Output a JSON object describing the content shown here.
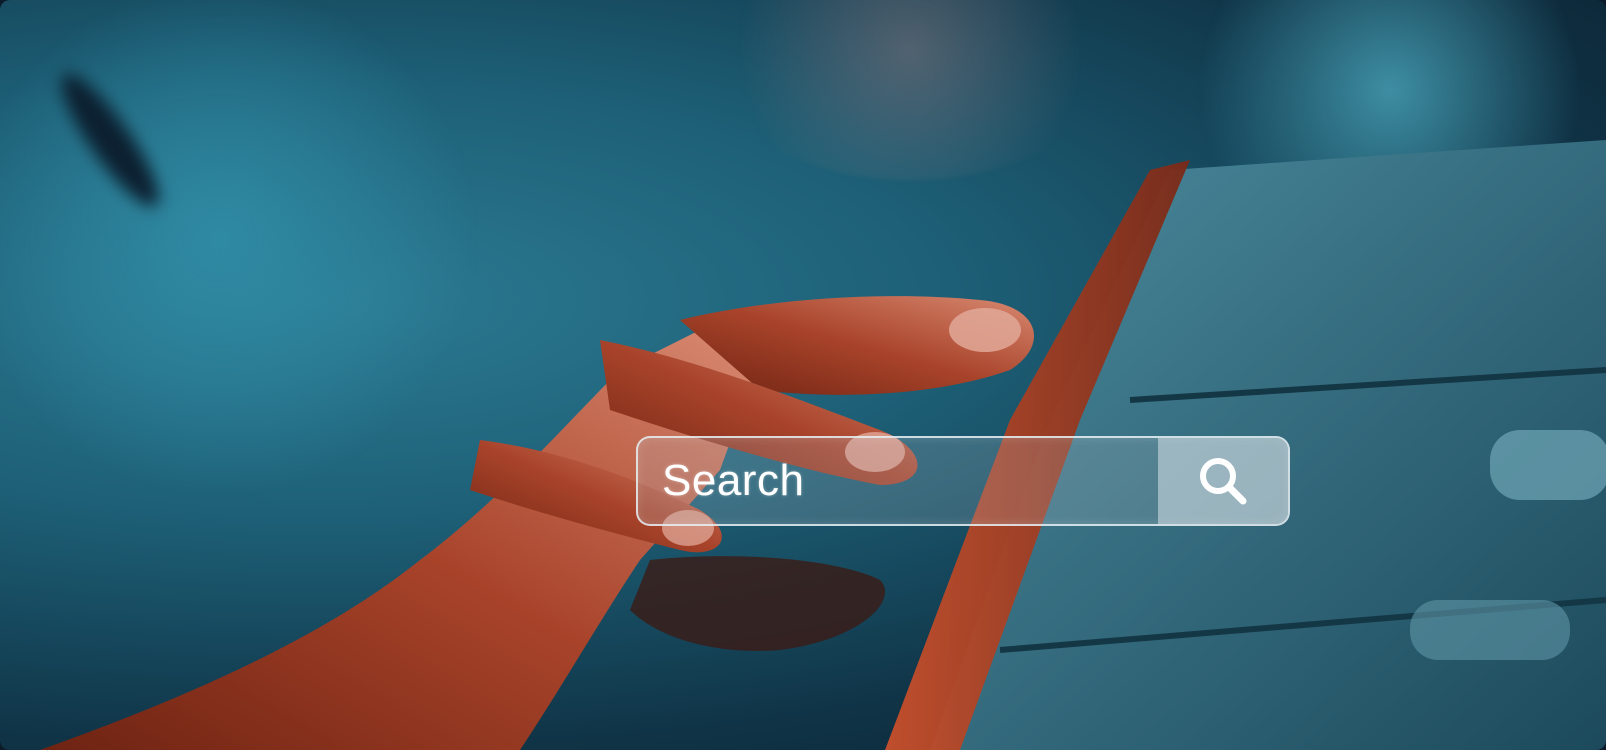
{
  "search": {
    "placeholder": "Search",
    "button_icon": "search-icon"
  },
  "colors": {
    "background_dark": "#0b1b2a",
    "background_teal": "#1d5f76",
    "hand_accent": "#b84a2e",
    "search_border": "#e6f0f5"
  }
}
